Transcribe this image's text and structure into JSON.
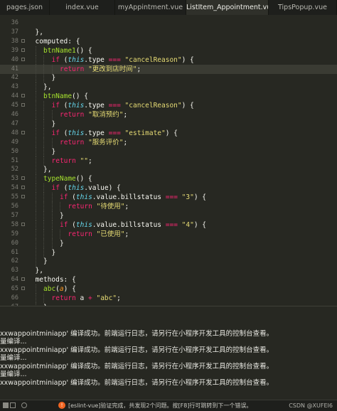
{
  "tabs": [
    {
      "label": "pages.json",
      "active": false
    },
    {
      "label": "index.vue",
      "active": false
    },
    {
      "label": "myAppintment.vue",
      "active": false
    },
    {
      "label": "ListItem_Appointment.vue",
      "active": true
    },
    {
      "label": "TipsPopup.vue",
      "active": false
    }
  ],
  "editor": {
    "lines": [
      {
        "n": "36",
        "t": "",
        "fold": false
      },
      {
        "n": "37",
        "t": "},",
        "fold": false
      },
      {
        "n": "38",
        "t": "computed: {",
        "fold": true
      },
      {
        "n": "39",
        "t": "btnName1() {",
        "fold": true
      },
      {
        "n": "40",
        "t": "if (this.type === \"cancelReason\") {",
        "fold": true
      },
      {
        "n": "41",
        "t": "return \"更改到店时间\";",
        "fold": false
      },
      {
        "n": "42",
        "t": "}",
        "fold": false
      },
      {
        "n": "43",
        "t": "},",
        "fold": false
      },
      {
        "n": "44",
        "t": "btnName() {",
        "fold": true
      },
      {
        "n": "45",
        "t": "if (this.type === \"cancelReason\") {",
        "fold": true
      },
      {
        "n": "46",
        "t": "return \"取消预约\";",
        "fold": false
      },
      {
        "n": "47",
        "t": "}",
        "fold": false
      },
      {
        "n": "48",
        "t": "if (this.type === \"estimate\") {",
        "fold": true
      },
      {
        "n": "49",
        "t": "return \"服务评价\";",
        "fold": false
      },
      {
        "n": "50",
        "t": "}",
        "fold": false
      },
      {
        "n": "51",
        "t": "return \"\";",
        "fold": false
      },
      {
        "n": "52",
        "t": "},",
        "fold": false
      },
      {
        "n": "53",
        "t": "typeName() {",
        "fold": true
      },
      {
        "n": "54",
        "t": "if (this.value) {",
        "fold": true
      },
      {
        "n": "55",
        "t": "if (this.value.billstatus === \"3\") {",
        "fold": true
      },
      {
        "n": "56",
        "t": "return \"待使用\";",
        "fold": false
      },
      {
        "n": "57",
        "t": "}",
        "fold": false
      },
      {
        "n": "58",
        "t": "if (this.value.billstatus === \"4\") {",
        "fold": true
      },
      {
        "n": "59",
        "t": "return \"已使用\";",
        "fold": false
      },
      {
        "n": "60",
        "t": "}",
        "fold": false
      },
      {
        "n": "61",
        "t": "}",
        "fold": false
      },
      {
        "n": "62",
        "t": "}",
        "fold": false
      },
      {
        "n": "63",
        "t": "},",
        "fold": false
      },
      {
        "n": "64",
        "t": "methods: {",
        "fold": true
      },
      {
        "n": "65",
        "t": "abc(a) {",
        "fold": true
      },
      {
        "n": "66",
        "t": "return a + \"abc\";",
        "fold": false
      },
      {
        "n": "67",
        "t": "}",
        "fold": false
      }
    ]
  },
  "console": {
    "lines": [
      "xxwappointminiapp' 编译成功。前端运行日志，请另行在小程序开发工具的控制台查看。",
      "量编译...",
      "xxwappointminiapp' 编译成功。前端运行日志，请另行在小程序开发工具的控制台查看。",
      "量编译...",
      "xxwappointminiapp' 编译成功。前端运行日志，请另行在小程序开发工具的控制台查看。",
      "量编译...",
      "xxwappointminiapp' 编译成功。前端运行日志，请另行在小程序开发工具的控制台查看。"
    ]
  },
  "status": {
    "message": "[eslint-vue]验证完成，共发现2个问题。按[F8]行可跳转到下一个错误。",
    "watermark": "CSDN @XUFEI6"
  },
  "colors": {
    "background": "#272822",
    "keyword": "#f92672",
    "function": "#a6e22e",
    "string": "#e6db74",
    "number": "#ae81ff",
    "builtin": "#66d9ef"
  }
}
